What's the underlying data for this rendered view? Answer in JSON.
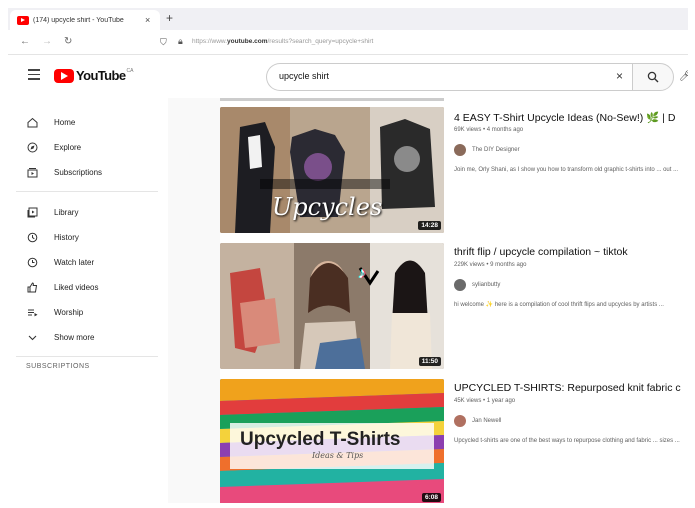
{
  "browser": {
    "tab_title": "(174) upcycle shirt - YouTube",
    "tab_close": "×",
    "new_tab": "+",
    "url_prefix": "https://www.",
    "url_domain": "youtube.com",
    "url_rest": "/results?search_query=upcycle+shirt"
  },
  "header": {
    "logo_text": "YouTube",
    "logo_region": "CA",
    "search_query": "upcycle shirt",
    "clear_label": "×"
  },
  "sidebar": {
    "items": [
      {
        "label": "Home",
        "icon": "home-icon"
      },
      {
        "label": "Explore",
        "icon": "compass-icon"
      },
      {
        "label": "Subscriptions",
        "icon": "subscriptions-icon"
      },
      {
        "label": "Library",
        "icon": "library-icon"
      },
      {
        "label": "History",
        "icon": "history-icon"
      },
      {
        "label": "Watch later",
        "icon": "clock-icon"
      },
      {
        "label": "Liked videos",
        "icon": "thumbs-up-icon"
      },
      {
        "label": "Worship",
        "icon": "playlist-icon"
      },
      {
        "label": "Show more",
        "icon": "chevron-down-icon"
      }
    ],
    "subscriptions_heading": "SUBSCRIPTIONS"
  },
  "results": [
    {
      "title": "4 EASY T-Shirt Upcycle Ideas (No-Sew!) 🌿 | D",
      "meta": "69K views • 4 months ago",
      "channel": "The DIY Designer",
      "description": "Join me, Orly Shani, as I show you how to transform old graphic t-shirts into ... out ...",
      "thumb_text": "Upcycles",
      "duration": "14:28",
      "channel_color": "#8a6a5a"
    },
    {
      "title": "thrift flip / upcycle compilation ~ tiktok",
      "meta": "229K views • 9 months ago",
      "channel": "sylianbutty",
      "description": "hi welcome ✨ here is a compilation of cool thrift flips and upcycles by artists ...",
      "thumb_text": "",
      "duration": "11:50",
      "channel_color": "#6a6a6a"
    },
    {
      "title": "UPCYCLED T-SHIRTS: Repurposed knit fabric c",
      "meta": "45K views • 1 year ago",
      "channel": "Jan Newell",
      "description": "Upcycled t-shirts are one of the best ways to repurpose clothing and fabric ... sizes ...",
      "thumb_text": "Upcycled T-Shirts",
      "thumb_subtext": "Ideas & Tips",
      "duration": "6:08",
      "channel_color": "#b07060"
    }
  ]
}
